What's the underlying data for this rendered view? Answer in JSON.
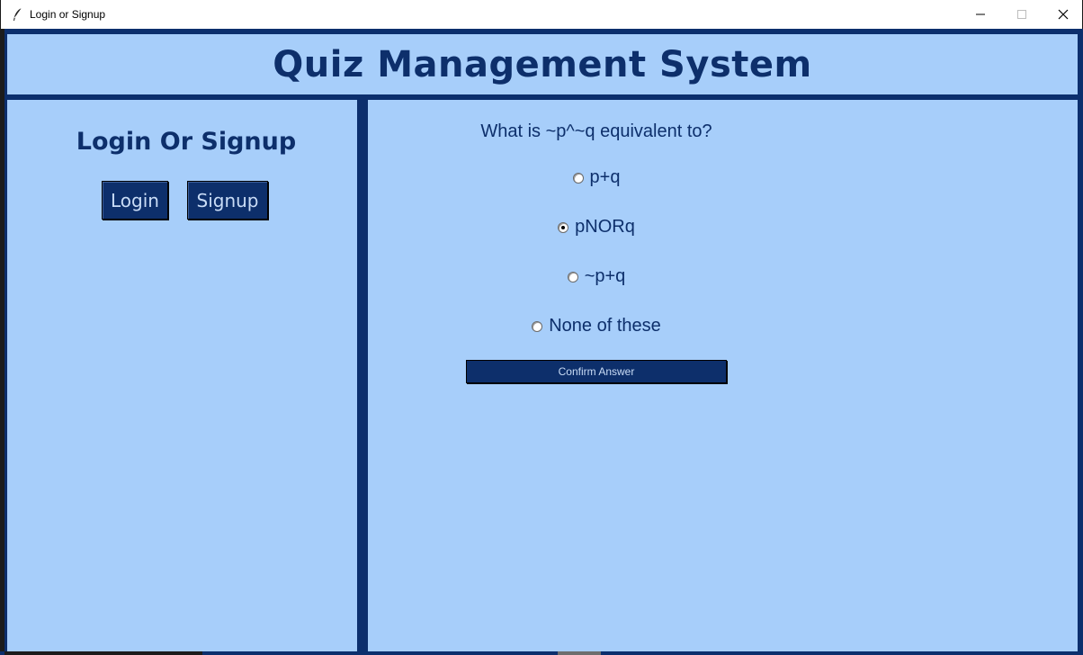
{
  "window": {
    "title": "Login or Signup",
    "controls": {
      "minimize_icon": "minimize-icon",
      "maximize_icon": "maximize-icon",
      "close_icon": "close-icon"
    }
  },
  "header": {
    "title": "Quiz Management System"
  },
  "sidebar": {
    "heading": "Login Or Signup",
    "login_label": "Login",
    "signup_label": "Signup"
  },
  "quiz": {
    "question": "What is ~p^~q equivalent to?",
    "options": [
      {
        "label": "p+q",
        "selected": false
      },
      {
        "label": "pNORq",
        "selected": true
      },
      {
        "label": "~p+q",
        "selected": false
      },
      {
        "label": "None of these",
        "selected": false
      }
    ],
    "confirm_label": "Confirm Answer"
  },
  "colors": {
    "panel_background": "#a7cefa",
    "frame_navy": "#0c2f6d",
    "text_navy": "#0d2f6b",
    "button_text": "#c9dcf6"
  }
}
